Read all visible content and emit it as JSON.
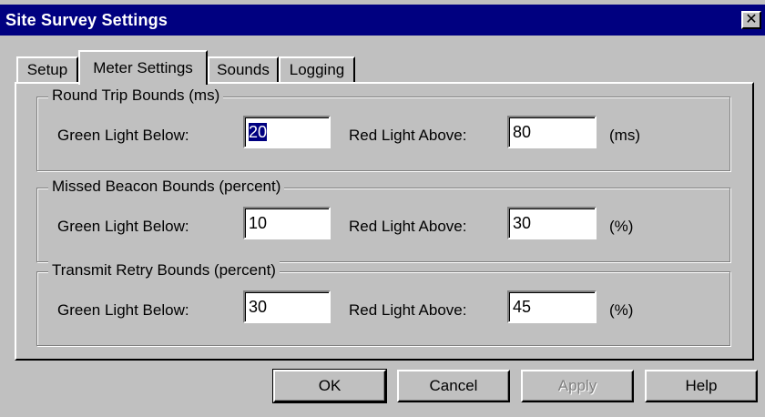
{
  "window": {
    "title": "Site Survey Settings",
    "close_glyph": "✕"
  },
  "tabs": [
    {
      "label": "Setup",
      "active": false
    },
    {
      "label": "Meter Settings",
      "active": true
    },
    {
      "label": "Sounds",
      "active": false
    },
    {
      "label": "Logging",
      "active": false
    }
  ],
  "groups": [
    {
      "title": "Round Trip Bounds (ms)",
      "green_label": "Green Light Below:",
      "green_value": "20",
      "red_label": "Red Light Above:",
      "red_value": "80",
      "unit": "(ms)"
    },
    {
      "title": "Missed Beacon Bounds (percent)",
      "green_label": "Green Light Below:",
      "green_value": "10",
      "red_label": "Red Light Above:",
      "red_value": "30",
      "unit": "(%)"
    },
    {
      "title": "Transmit Retry Bounds (percent)",
      "green_label": "Green Light Below:",
      "green_value": "30",
      "red_label": "Red Light Above:",
      "red_value": "45",
      "unit": "(%)"
    }
  ],
  "buttons": {
    "ok": "OK",
    "cancel": "Cancel",
    "apply": "Apply",
    "help": "Help"
  }
}
